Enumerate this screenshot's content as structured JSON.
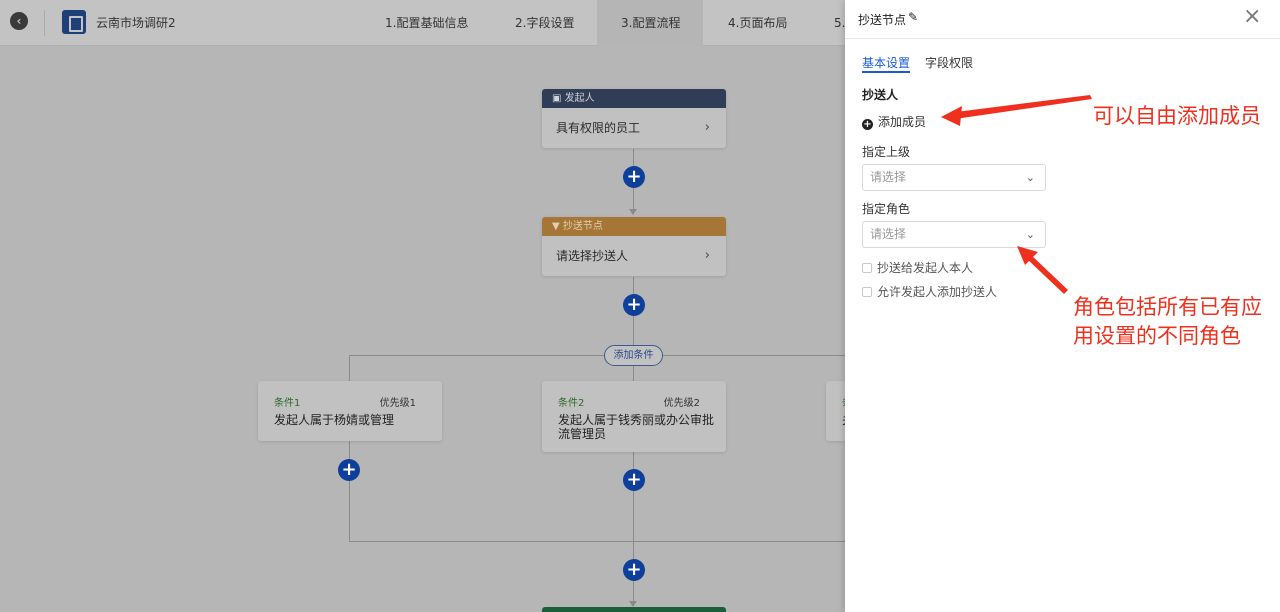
{
  "header": {
    "app_name": "云南市场调研2",
    "steps": [
      {
        "label": "1.配置基础信息"
      },
      {
        "label": "2.字段设置"
      },
      {
        "label": "3.配置流程"
      },
      {
        "label": "4.页面布局"
      },
      {
        "label": "5.:"
      }
    ]
  },
  "flow": {
    "initiator_node": {
      "title": "发起人",
      "body": "具有权限的员工"
    },
    "cc_node": {
      "title": "抄送节点",
      "body": "请选择抄送人"
    },
    "add_condition_label": "添加条件",
    "conditions": [
      {
        "name": "条件1",
        "priority": "优先级1",
        "desc": "发起人属于杨婧或管理"
      },
      {
        "name": "条件2",
        "priority": "优先级2",
        "desc": "发起人属于钱秀丽或办公审批流管理员"
      },
      {
        "name": "条",
        "priority": "",
        "desc": "关"
      }
    ]
  },
  "panel": {
    "title": "抄送节点",
    "tabs": [
      {
        "label": "基本设置"
      },
      {
        "label": "字段权限"
      }
    ],
    "section_title": "抄送人",
    "add_member_label": "添加成员",
    "superior_label": "指定上级",
    "superior_placeholder": "请选择",
    "role_label": "指定角色",
    "role_placeholder": "请选择",
    "checkbox_cc_self": "抄送给发起人本人",
    "checkbox_allow_add": "允许发起人添加抄送人"
  },
  "annotations": {
    "member_note": "可以自由添加成员",
    "role_note_line1": "角色包括所有已有应",
    "role_note_line2": "用设置的不同角色"
  },
  "colors": {
    "accent_blue": "#1a5cd6",
    "annotation_red": "#f0301e",
    "initiator_header": "#2f3e56",
    "cc_header": "#a57636",
    "plus_button": "#0e3f9b"
  }
}
